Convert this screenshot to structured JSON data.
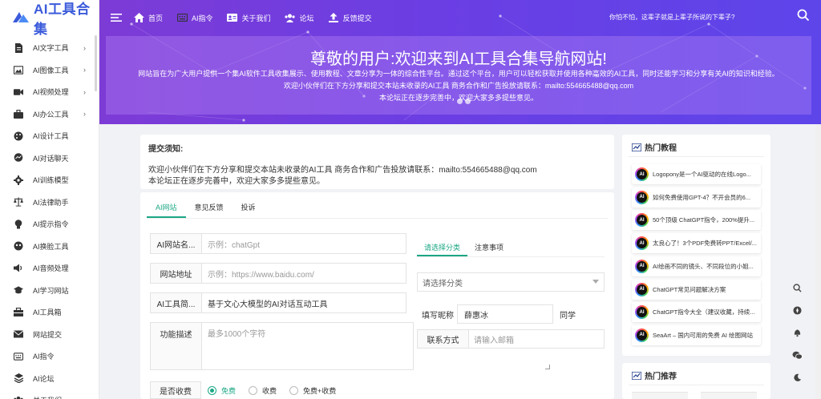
{
  "logo": {
    "text": "AI工具合集"
  },
  "sidebar": {
    "items": [
      {
        "label": "AI文字工具",
        "icon": "document-icon",
        "has_arrow": true
      },
      {
        "label": "AI图像工具",
        "icon": "image-icon",
        "has_arrow": true
      },
      {
        "label": "AI视频处理",
        "icon": "video-icon",
        "has_arrow": true
      },
      {
        "label": "AI办公工具",
        "icon": "briefcase-icon",
        "has_arrow": true
      },
      {
        "label": "AI设计工具",
        "icon": "palette-icon",
        "has_arrow": false
      },
      {
        "label": "AI对话聊天",
        "icon": "messenger-icon",
        "has_arrow": false
      },
      {
        "label": "AI训练模型",
        "icon": "gear-icon",
        "has_arrow": false
      },
      {
        "label": "AI法律助手",
        "icon": "scale-icon",
        "has_arrow": false
      },
      {
        "label": "AI提示指令",
        "icon": "lightbulb-icon",
        "has_arrow": false
      },
      {
        "label": "AI换脸工具",
        "icon": "mask-icon",
        "has_arrow": false
      },
      {
        "label": "AI音频处理",
        "icon": "audio-icon",
        "has_arrow": false
      },
      {
        "label": "AI学习网站",
        "icon": "graduation-icon",
        "has_arrow": false
      },
      {
        "label": "AI工具箱",
        "icon": "toolbox-icon",
        "has_arrow": false
      },
      {
        "label": "网站提交",
        "icon": "mail-icon",
        "has_arrow": false
      },
      {
        "label": "AI指令",
        "icon": "keyboard-icon",
        "has_arrow": false
      },
      {
        "label": "AI论坛",
        "icon": "forum-icon",
        "has_arrow": false
      },
      {
        "label": "关于我们",
        "icon": "users-icon",
        "has_arrow": false
      }
    ]
  },
  "topnav": {
    "items": [
      {
        "label": "首页",
        "icon": "home-icon"
      },
      {
        "label": "AI指令",
        "icon": "keyboard-icon"
      },
      {
        "label": "关于我们",
        "icon": "id-card-icon"
      },
      {
        "label": "论坛",
        "icon": "users-icon"
      },
      {
        "label": "反馈提交",
        "icon": "upload-icon"
      }
    ],
    "slogan": "你怕不怕，这辈子就是上辈子所说的下辈子?"
  },
  "hero": {
    "title": "尊敬的用户:欢迎来到AI工具合集导航网站!",
    "line1": "网站旨在为广大用户提供一个集AI软件工具收集展示、使用教程、文章分享为一体的综合性平台。通过这个平台，用户可以轻松获取并使用各种高效的AI工具，同时还能学习和分享有关AI的知识和经验。",
    "line2": "欢迎小伙伴们在下方分享和提交本站未收录的AI工具 商务合作和广告投放请联系：mailto:554665488@qq.com",
    "line3": "本论坛正在逐步完善中，欢迎大家多多提些意见。"
  },
  "notice": {
    "title": "提交须知:",
    "line1": "欢迎小伙伴们在下方分享和提交本站未收录的AI工具 商务合作和广告投放请联系：mailto:554665488@qq.com",
    "line2": "本论坛正在逐步完善中，欢迎大家多多提些意见。"
  },
  "form": {
    "tabs": [
      "AI网站",
      "意见反馈",
      "投诉"
    ],
    "fields": {
      "name": {
        "label": "AI网站名...",
        "placeholder": "示例：chatGpt"
      },
      "url": {
        "label": "网站地址",
        "placeholder": "示例：https://www.baidu.com/"
      },
      "intro": {
        "label": "AI工具简...",
        "value": "基于文心大模型的AI对话互动工具"
      },
      "desc": {
        "label": "功能描述",
        "placeholder": "最多1000个字符"
      }
    },
    "right_tabs": [
      "请选择分类",
      "注意事项"
    ],
    "category_placeholder": "请选择分类",
    "nickname_label": "填写昵称",
    "nickname_value": "薛惠冰",
    "nickname_suffix": "同学",
    "contact_label": "联系方式",
    "contact_placeholder": "请输入邮箱",
    "fee_label": "是否收费",
    "fee_options": [
      "免费",
      "收费",
      "免费+收费"
    ],
    "fee_selected": "免费"
  },
  "hot": {
    "title": "热门教程",
    "items": [
      "Logopony是一个AI驱动的在线Logo...",
      "如何免费使用GPT-4？不开会员的6...",
      "50个顶级 ChatGPT指令，200%提升...",
      "太良心了！3个PDF免费转PPT/Excel/...",
      "AI绘画不同的镜头、不同段位的小姐...",
      "ChatGPT常见问题解决方案",
      "ChatGPT指令大全（建议收藏，持续...",
      "SeaArt – 国内可用的免费 AI 绘图网站"
    ],
    "avatar_text": "AI"
  },
  "recommend": {
    "title": "热门推荐"
  },
  "tools": [
    "search-icon",
    "compass-icon",
    "bell-icon",
    "wechat-icon",
    "moon-icon"
  ],
  "colors": {
    "accent": "#1ba784",
    "banner_start": "#7d3bd6",
    "banner_end": "#5d45ea",
    "logo": "#3b5bdb"
  }
}
